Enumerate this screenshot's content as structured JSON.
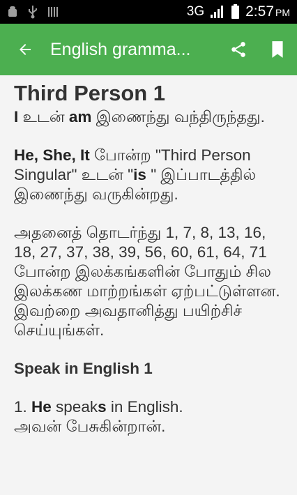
{
  "status_bar": {
    "network": "3G",
    "time": "2:57",
    "ampm": "PM"
  },
  "toolbar": {
    "title": "English gramma..."
  },
  "content": {
    "title": "Third Person 1",
    "p1": {
      "b1": "I",
      "t1": " உடன் ",
      "b2": "am",
      "t2": " இணைந்து வந்திருந்தது."
    },
    "p2": {
      "b1": "He, She, It",
      "t1": " போன்ற \"Third Person Singular\" உடன் \"",
      "b2": "is",
      "t2": " \" இப்பாடத்தில் இணைந்து வருகின்றது."
    },
    "p3": "அதனைத் தொடர்ந்து 1, 7, 8, 13, 16, 18, 27, 37, 38, 39, 56, 60, 61, 64, 71 போன்ற இலக்கங்களின் போதும் சில இலக்கண மாற்றங்கள் ஏற்பட்டுள்ளன. இவற்றை அவதானித்து பயிற்சிச் செய்யுங்கள்.",
    "section_heading": "Speak in English 1",
    "ex1": {
      "num": "1. ",
      "b1": "He",
      "t1": " speak",
      "b2": "s",
      "t2": " in English."
    },
    "ex1_translation": "அவன் பேசுகின்றான்."
  }
}
